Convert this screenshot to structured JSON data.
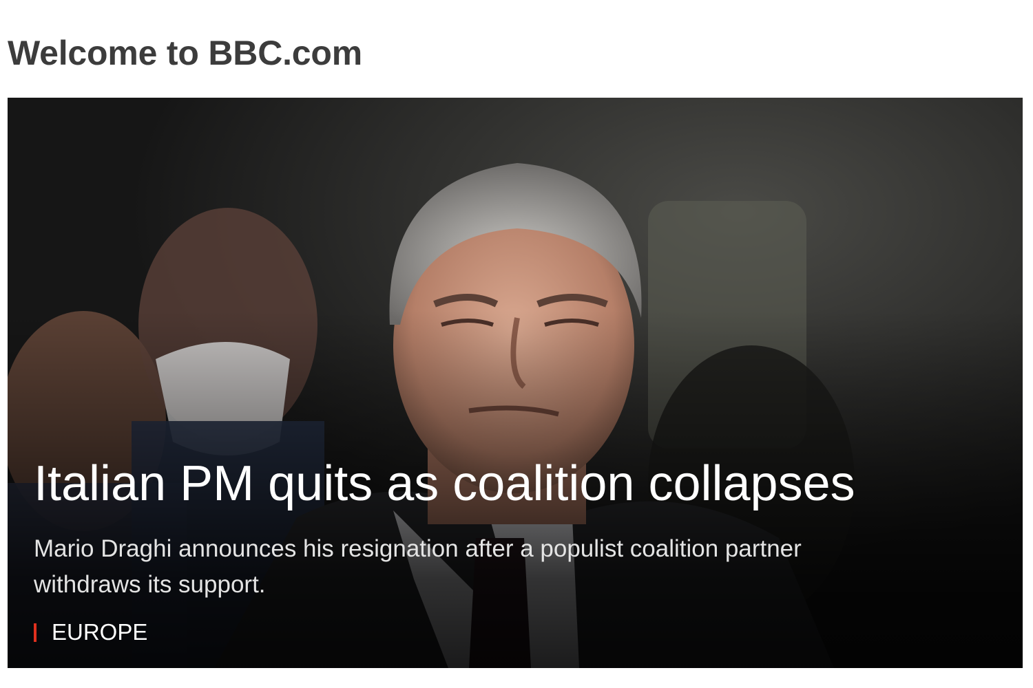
{
  "page": {
    "heading": "Welcome to BBC.com"
  },
  "hero": {
    "image_icon": "photo-of-man-in-suit",
    "title": "Italian PM quits as coalition collapses",
    "summary": "Mario Draghi announces his resignation after a populist coalition partner withdraws its support.",
    "section": "EUROPE",
    "section_accent": "#e0301e"
  }
}
